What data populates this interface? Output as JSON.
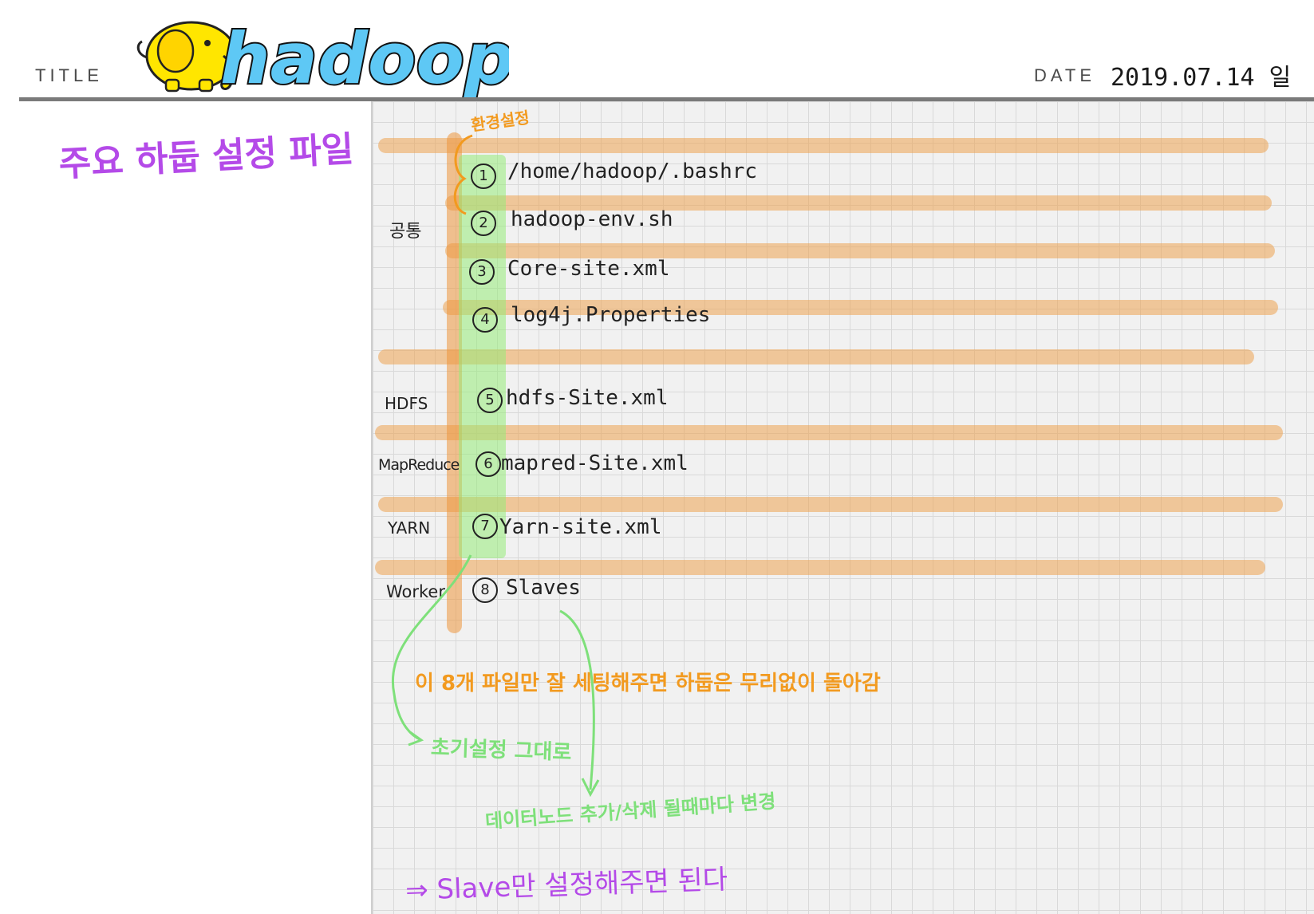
{
  "header": {
    "title_label": "TITLE",
    "logo_text": "hadoop",
    "date_label": "DATE",
    "date_value": "2019.07.14 일"
  },
  "page_heading": "주요 하둡 설정 파일",
  "annotation_top": "환경설정",
  "groups": [
    {
      "label": "공통"
    },
    {
      "label": "HDFS"
    },
    {
      "label": "MapReduce"
    },
    {
      "label": "YARN"
    },
    {
      "label": "Worker"
    }
  ],
  "files": [
    {
      "num": "1",
      "name": "/home/hadoop/.bashrc"
    },
    {
      "num": "2",
      "name": "hadoop-env.sh"
    },
    {
      "num": "3",
      "name": "Core-site.xml"
    },
    {
      "num": "4",
      "name": "log4j.Properties"
    },
    {
      "num": "5",
      "name": "hdfs-Site.xml"
    },
    {
      "num": "6",
      "name": "mapred-Site.xml"
    },
    {
      "num": "7",
      "name": "Yarn-site.xml"
    },
    {
      "num": "8",
      "name": "Slaves"
    }
  ],
  "notes": {
    "orange_main": "이 8개 파일만 잘 세팅해주면 하둡은 무리없이 돌아감",
    "green_initial": "초기설정 그대로",
    "green_datanode": "데이터노드 추가/삭제 될때마다 변경",
    "purple_bottom": "⇒ Slave만 설정해주면 된다"
  },
  "colors": {
    "highlight_orange": "#eda250",
    "highlight_green": "#96eb78",
    "heading_purple": "#b44ae8",
    "note_orange": "#f29a1f",
    "note_green": "#7ee07a",
    "logo_yellow": "#ffe600",
    "logo_blue": "#5ec8f5"
  }
}
